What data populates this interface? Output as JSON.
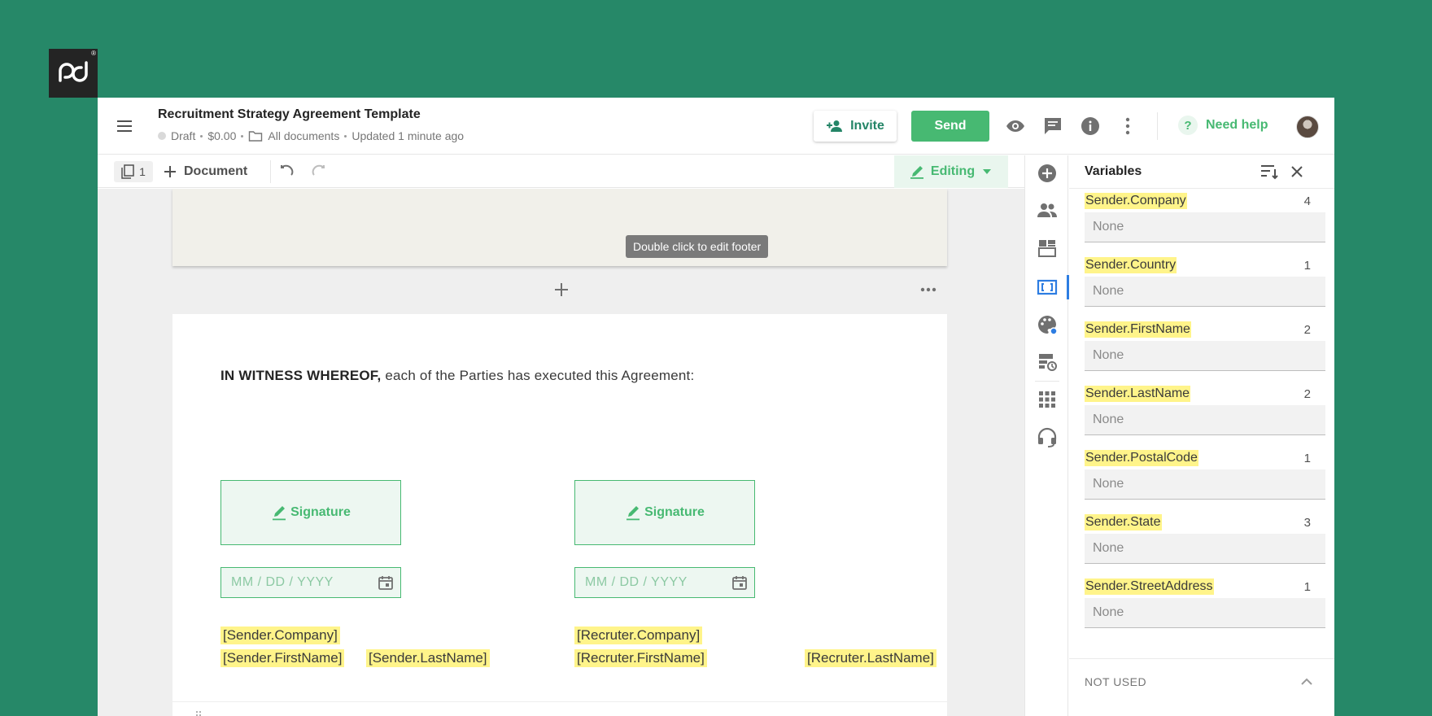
{
  "header": {
    "doc_title": "Recruitment Strategy Agreement Template",
    "status": "Draft",
    "price": "$0.00",
    "folder": "All documents",
    "updated": "Updated 1 minute ago",
    "invite_label": "Invite",
    "send_label": "Send",
    "help_label": "Need help",
    "help_icon_glyph": "?"
  },
  "toolbar": {
    "pages_count": "1",
    "document_label": "Document",
    "mode_label": "Editing"
  },
  "canvas": {
    "footer_tooltip": "Double click to edit footer",
    "witness_bold": "IN WITNESS WHEREOF,",
    "witness_rest": " each of the Parties has executed this Agreement:",
    "signature_label": "Signature",
    "date_placeholder": "MM / DD / YYYY",
    "left_tags": [
      "[Sender.Company]",
      "[Sender.FirstName]",
      "[Sender.LastName]"
    ],
    "right_tags": [
      "[Recruter.Company]",
      "[Recruter.FirstName]",
      "[Recruter.LastName]"
    ]
  },
  "panel": {
    "title": "Variables",
    "variables": [
      {
        "name": "Sender.Company",
        "count": "4",
        "placeholder": "None"
      },
      {
        "name": "Sender.Country",
        "count": "1",
        "placeholder": "None"
      },
      {
        "name": "Sender.FirstName",
        "count": "2",
        "placeholder": "None"
      },
      {
        "name": "Sender.LastName",
        "count": "2",
        "placeholder": "None"
      },
      {
        "name": "Sender.PostalCode",
        "count": "1",
        "placeholder": "None"
      },
      {
        "name": "Sender.State",
        "count": "3",
        "placeholder": "None"
      },
      {
        "name": "Sender.StreetAddress",
        "count": "1",
        "placeholder": "None"
      }
    ],
    "not_used_label": "NOT USED"
  },
  "colors": {
    "background": "#268868",
    "brand_green": "#47b972",
    "variable_highlight": "#fff48a",
    "active_rail": "#2d7de2"
  },
  "icons": [
    "pandadoc-logo",
    "hamburger-menu-icon",
    "add-person-icon",
    "eye-icon",
    "comment-icon",
    "info-icon",
    "more-vertical-icon",
    "help-icon",
    "pages-icon",
    "plus-icon",
    "undo-icon",
    "redo-icon",
    "pencil-icon",
    "chevron-down-icon",
    "calendar-icon",
    "add-circle-icon",
    "recipients-icon",
    "content-icon",
    "variables-icon",
    "design-icon",
    "fields-icon",
    "apps-icon",
    "headset-icon",
    "sort-icon",
    "close-icon",
    "chevron-up-icon"
  ]
}
